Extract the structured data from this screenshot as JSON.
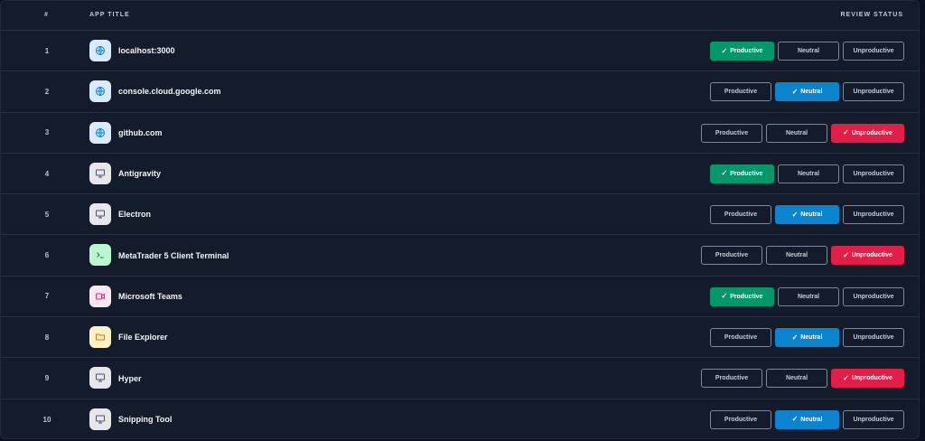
{
  "header": {
    "num": "#",
    "title": "APP TITLE",
    "status": "REVIEW STATUS"
  },
  "labels": {
    "productive": "Productive",
    "neutral": "Neutral",
    "unproductive": "Unproductive",
    "check": "✓"
  },
  "colors": {
    "productive": "#059669",
    "neutral": "#0a84cf",
    "unproductive": "#e11d48"
  },
  "rows": [
    {
      "num": "1",
      "name": "localhost:3000",
      "icon": "globe-icon",
      "status": "productive"
    },
    {
      "num": "2",
      "name": "console.cloud.google.com",
      "icon": "globe-icon",
      "status": "neutral"
    },
    {
      "num": "3",
      "name": "github.com",
      "icon": "globe-icon",
      "status": "unproductive"
    },
    {
      "num": "4",
      "name": "Antigravity",
      "icon": "monitor-icon",
      "status": "productive"
    },
    {
      "num": "5",
      "name": "Electron",
      "icon": "monitor-icon",
      "status": "neutral"
    },
    {
      "num": "6",
      "name": "MetaTrader 5 Client Terminal",
      "icon": "terminal-icon",
      "status": "unproductive"
    },
    {
      "num": "7",
      "name": "Microsoft Teams",
      "icon": "video-icon",
      "status": "productive"
    },
    {
      "num": "8",
      "name": "File Explorer",
      "icon": "folder-icon",
      "status": "neutral"
    },
    {
      "num": "9",
      "name": "Hyper",
      "icon": "monitor-icon",
      "status": "unproductive"
    },
    {
      "num": "10",
      "name": "Snipping Tool",
      "icon": "monitor-icon",
      "status": "neutral"
    }
  ]
}
